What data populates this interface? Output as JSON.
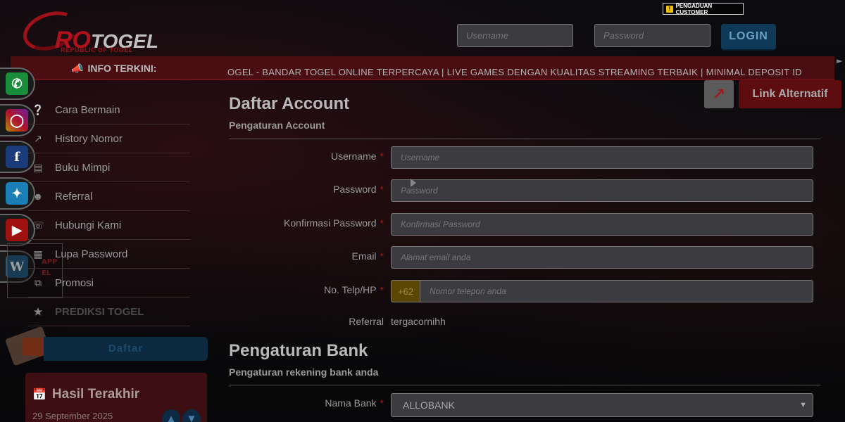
{
  "header": {
    "complaint_label": "PENGADUAN CUSTOMER",
    "logo_brand_ro": "RO",
    "logo_brand_rest": "TOGEL",
    "logo_tagline": "REPUBLIC OF TOGEL",
    "username_placeholder": "Username",
    "password_placeholder": "Password",
    "login_label": "LOGIN"
  },
  "ticker": {
    "label": "INFO TERKINI:",
    "text": "OGEL - BANDAR TOGEL ONLINE TERPERCAYA | LIVE GAMES DENGAN KUALITAS STREAMING TERBAIK | MINIMAL DEPOSIT ID"
  },
  "social": {
    "whatsapp": "whatsapp-icon",
    "instagram": "instagram-icon",
    "facebook": "facebook-icon",
    "twitter": "twitter-icon",
    "youtube": "youtube-icon",
    "wordpress": "wordpress-icon"
  },
  "menu": {
    "items": [
      {
        "label": "Cara Bermain"
      },
      {
        "label": "History Nomor"
      },
      {
        "label": "Buku Mimpi"
      },
      {
        "label": "Referral"
      },
      {
        "label": "Hubungi Kami"
      },
      {
        "label": "Lupa Password"
      },
      {
        "label": "Promosi"
      },
      {
        "label": "PREDIKSI TOGEL"
      }
    ],
    "app_text_1": "APP",
    "app_text_2": "EL",
    "daftar_label": "Daftar"
  },
  "result": {
    "title": "Hasil Terakhir",
    "date": "29 September 2025"
  },
  "form": {
    "title": "Daftar Account",
    "subtitle": "Pengaturan Account",
    "username_label": "Username",
    "username_placeholder": "Username",
    "password_label": "Password",
    "password_placeholder": "Password",
    "confirm_label": "Konfirmasi Password",
    "confirm_placeholder": "Konfirmasi Password",
    "email_label": "Email",
    "email_placeholder": "Alamat email anda",
    "phone_label": "No. Telp/HP",
    "phone_prefix": "+62",
    "phone_placeholder": "Nomor telepon anda",
    "referral_label": "Referral",
    "referral_value": "tergacornihh",
    "required_mark": "*",
    "bank_title": "Pengaturan Bank",
    "bank_subtitle": "Pengaturan rekening bank anda",
    "bank_label": "Nama Bank",
    "bank_value": "ALLOBANK"
  },
  "alt": {
    "label": "Link Alternatif"
  }
}
